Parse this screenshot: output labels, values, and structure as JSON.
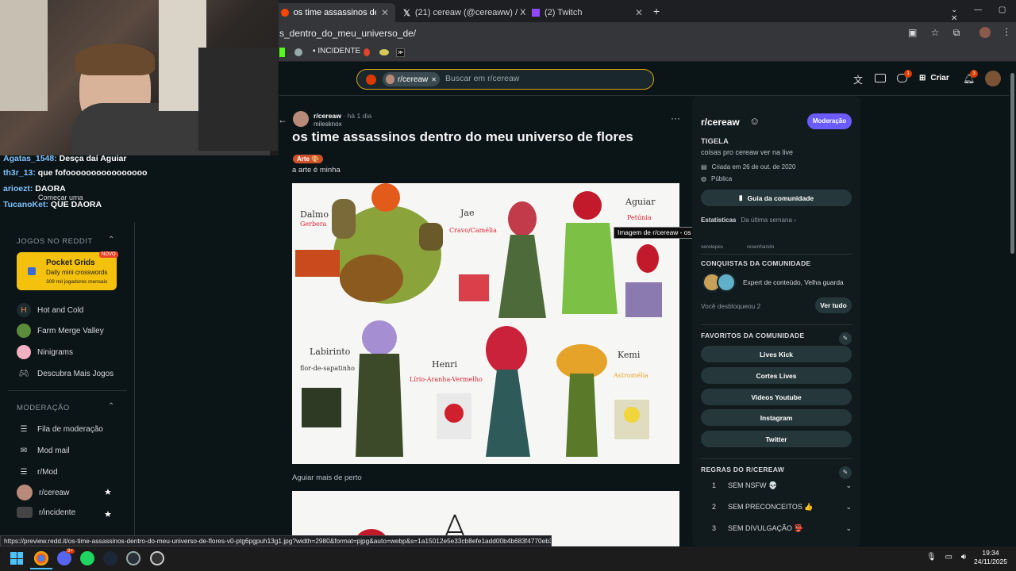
{
  "browser": {
    "tabs": [
      {
        "label": "os time assassinos dentro do m",
        "icon": "reddit-icon",
        "active": true
      },
      {
        "label": "(21) cereaw (@cereaww) / X",
        "icon": "x-icon",
        "active": false
      },
      {
        "label": "(2) Twitch",
        "icon": "twitch-icon",
        "active": false
      }
    ],
    "url": "s_dentro_do_meu_universo_de/",
    "bookmarks": [
      "INCIDENTE"
    ]
  },
  "stream_chat": [
    {
      "user": "Agatas_1548:",
      "text": "Desça daí Aguiar"
    },
    {
      "user": "th3r_13:",
      "text": "que fofoooooooooooooooo"
    },
    {
      "user": "arioezt:",
      "text": "DAORA"
    },
    {
      "user": "TucanoKet:",
      "text": "QUE DAORA"
    }
  ],
  "stream_overlay_text": "Começar uma",
  "reddit_header": {
    "search_chip": "r/cereaw",
    "search_placeholder": "Buscar em r/cereaw",
    "create_label": "Criar",
    "chat_badge": "1",
    "notif_badge": "3"
  },
  "left_sidebar": {
    "games_section": "JOGOS NO REDDIT",
    "featured_game": {
      "title": "Pocket Grids",
      "subtitle": "Daily mini crosswords",
      "players": "309 mil jogadores mensais",
      "badge": "NOVO"
    },
    "games": [
      "Hot and Cold",
      "Farm Merge Valley",
      "Ninigrams",
      "Descubra Mais Jogos"
    ],
    "mod_section": "MODERAÇÃO",
    "mod_items": [
      "Fila de moderação",
      "Mod mail",
      "r/Mod",
      "r/cereaw",
      "r/incidente"
    ]
  },
  "post": {
    "subreddit": "r/cereaw",
    "time": "· há 1 dia",
    "author": "milesknox",
    "title": "os time assassinos dentro do meu universo de flores",
    "flair": "Arte 🎨",
    "body": "a arte é minha",
    "caption": "Aguiar mais de perto",
    "tooltip": "Imagem de r/cereaw - os time assassinos dentro do meu universo de flores",
    "artwork_labels": [
      "Dalmo",
      "Gerbera",
      "Jae",
      "Cravo/Camélia",
      "Aguiar",
      "Petúnia",
      "Labirinto",
      "flor-de-sapatinho",
      "Henri",
      "Lírio-Aranha-Vermelho",
      "Kemi",
      "Astromélia"
    ]
  },
  "right_sidebar": {
    "name": "r/cereaw",
    "mod_button": "Moderação",
    "header": "TIGELA",
    "description": "coisas pro cereaw ver na live",
    "created": "Criada em 26 de out. de 2020",
    "visibility": "Pública",
    "guide_button": "Guia da comunidade",
    "stats_label": "Estatísticas",
    "stats_period": "Da última semana ›",
    "stats_sub": [
      "serelepes",
      "resenhando"
    ],
    "achievements_title": "CONQUISTAS DA COMUNIDADE",
    "achievements_text": "Expert de conteúdo, Velha guarda",
    "unlocked": "Você desbloqueou 2",
    "see_all": "Ver tudo",
    "favorites_title": "FAVORITOS DA COMUNIDADE",
    "favorites": [
      "Lives Kick",
      "Cortes Lives",
      "Videos Youtube",
      "Instagram",
      "Twitter"
    ],
    "rules_title": "REGRAS DO R/CEREAW",
    "rules": [
      {
        "num": "1",
        "text": "SEM NSFW 💀"
      },
      {
        "num": "2",
        "text": "SEM PRECONCEITOS 👍"
      },
      {
        "num": "3",
        "text": "SEM DIVULGAÇÃO 👺"
      }
    ]
  },
  "status_url": "https://preview.redd.it/os-time-assassinos-dentro-do-meu-universo-de-flores-v0-ptg6pgpuh13g1.jpg?width=2980&format=pjpg&auto=webp&s=1a15012e5e33cb8efe1add00b4b683f4770eb307",
  "taskbar": {
    "time": "19:34",
    "date": "24/11/2025",
    "discord_badge": "9+"
  },
  "colors": {
    "accent": "#d93a00",
    "mod": "#6a5cff",
    "search_border": "#d8a21a"
  }
}
